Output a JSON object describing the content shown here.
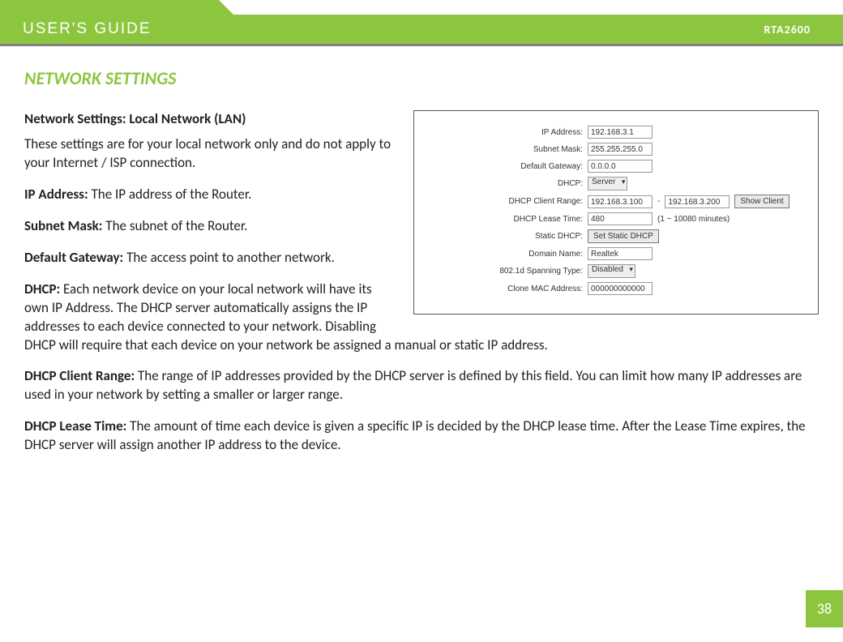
{
  "header": {
    "title": "USER'S GUIDE",
    "model": "RTA2600"
  },
  "section_title": "NETWORK SETTINGS",
  "subsection_title": "Network Settings: Local Network (LAN)",
  "intro": "These settings are for your local network only and do not apply to your Internet / ISP connection.",
  "defs": {
    "ip_label": "IP Address:",
    "ip_text": " The IP address of the Router.",
    "subnet_label": "Subnet Mask:",
    "subnet_text": " The subnet of the Router.",
    "gw_label": "Default Gateway:",
    "gw_text": " The access point to another network.",
    "dhcp_label": "DHCP:",
    "dhcp_text": " Each network device on your local network will have its own IP Address.  The DHCP server automatically assigns the IP addresses to each device connected to your network.  Disabling DHCP will require that each device on your network be assigned a manual or static IP address.",
    "range_label": "DHCP Client Range:",
    "range_text": " The range of IP addresses provided by the DHCP server is defined by this field.  You can limit how many IP addresses are used in your network by setting a smaller or larger range.",
    "lease_label": "DHCP Lease Time:",
    "lease_text": " The amount of time each device is given a specific IP is decided by the DHCP lease time.  After the Lease Time expires, the DHCP server will assign another IP address to the device."
  },
  "figure": {
    "labels": {
      "ip": "IP Address:",
      "subnet": "Subnet Mask:",
      "gateway": "Default Gateway:",
      "dhcp": "DHCP:",
      "range": "DHCP Client Range:",
      "lease": "DHCP Lease Time:",
      "static": "Static DHCP:",
      "domain": "Domain Name:",
      "spanning": "802.1d Spanning Type:",
      "clone": "Clone MAC Address:"
    },
    "values": {
      "ip": "192.168.3.1",
      "subnet": "255.255.255.0",
      "gateway": "0.0.0.0",
      "dhcp": "Server",
      "range_start": "192.168.3.100",
      "range_dash": "-",
      "range_end": "192.168.3.200",
      "show_client": "Show Client",
      "lease": "480",
      "lease_note": "(1 ~ 10080 minutes)",
      "static_btn": "Set Static DHCP",
      "domain": "Realtek",
      "spanning": "Disabled",
      "clone": "000000000000"
    }
  },
  "page_number": "38"
}
